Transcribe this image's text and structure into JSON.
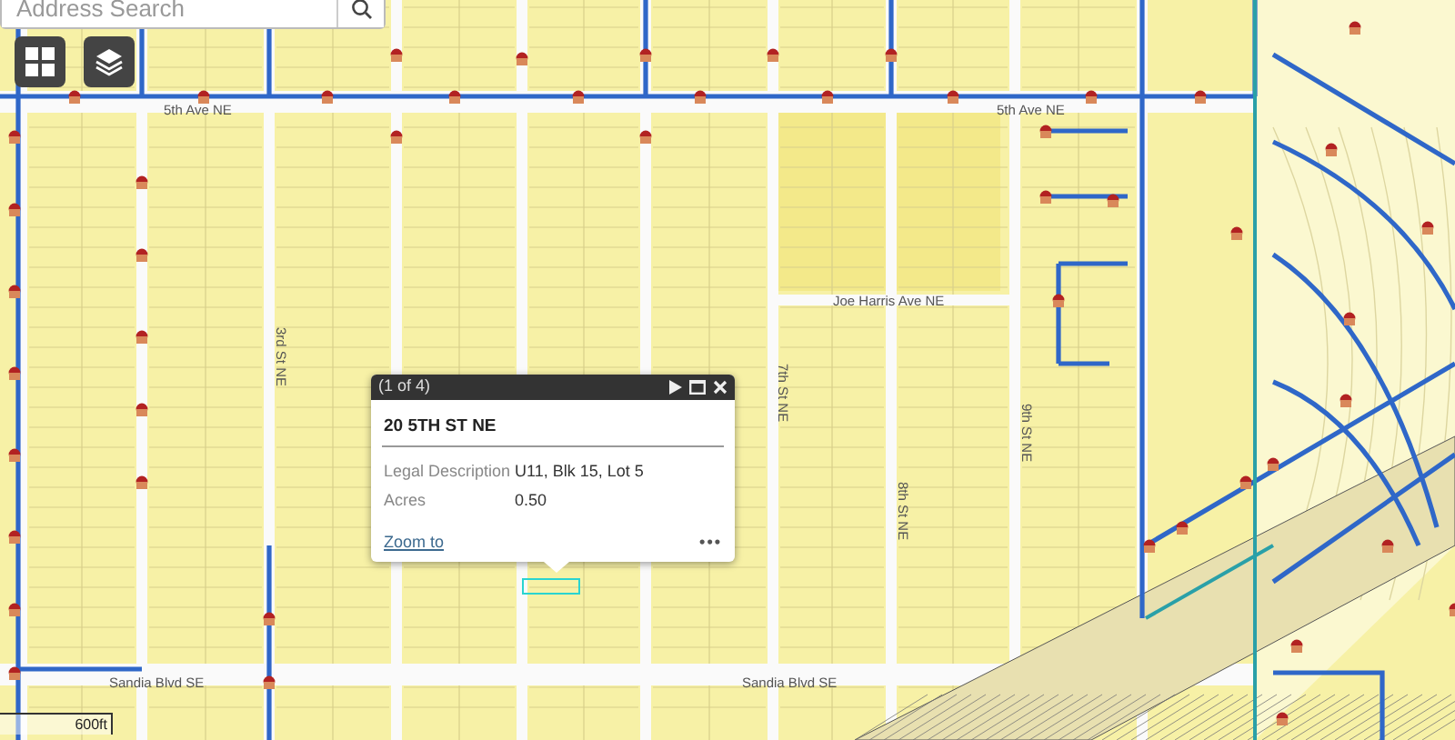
{
  "search": {
    "placeholder": "Address Search"
  },
  "map_labels": [
    {
      "text": "5th Ave NE",
      "kind": "horizontal"
    },
    {
      "text": "5th Ave NE",
      "kind": "horizontal"
    },
    {
      "text": "Joe Harris Ave NE",
      "kind": "horizontal"
    },
    {
      "text": "3rd St NE",
      "kind": "vertical"
    },
    {
      "text": "7th St NE",
      "kind": "vertical"
    },
    {
      "text": "8th St NE",
      "kind": "vertical"
    },
    {
      "text": "9th St NE",
      "kind": "vertical"
    },
    {
      "text": "Sandia Blvd SE",
      "kind": "horizontal"
    },
    {
      "text": "Sandia Blvd SE",
      "kind": "horizontal"
    }
  ],
  "popup": {
    "counter": "(1 of 4)",
    "title": "20 5TH ST NE",
    "fields": [
      {
        "label": "Legal Description",
        "value": "U11, Blk 15, Lot 5"
      },
      {
        "label": "Acres",
        "value": "0.50"
      }
    ],
    "zoom_link": "Zoom to",
    "more": "•••"
  },
  "scale_bar": {
    "label": "600ft"
  }
}
